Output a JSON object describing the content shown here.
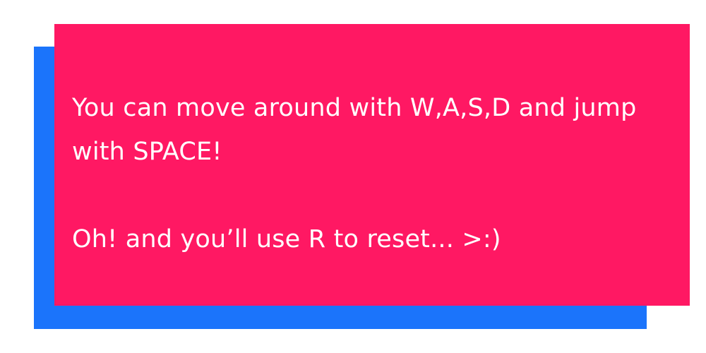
{
  "colors": {
    "dialog_bg": "#ff1863",
    "shadow_bg": "#1b74fb",
    "text": "#ffffff"
  },
  "dialog": {
    "line1": "You can move around with W,A,S,D and jump",
    "line2": "with SPACE!",
    "line3": "Oh! and you’ll use R to reset... >:)"
  }
}
